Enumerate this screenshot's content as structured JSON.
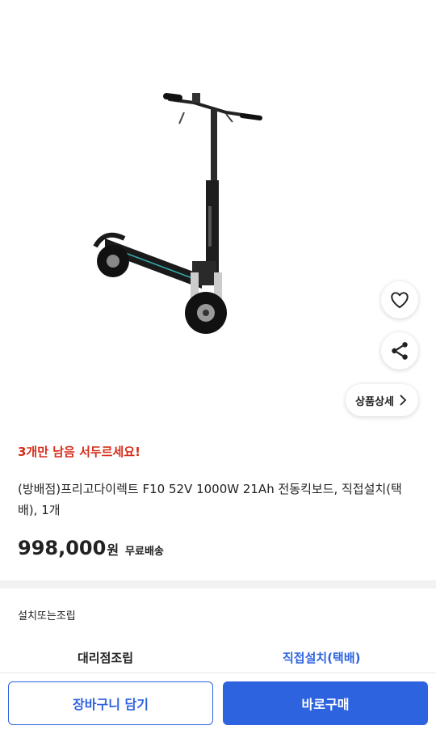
{
  "product": {
    "image_alt": "electric-scooter-image",
    "stock_notice": "3개만 남음 서두르세요!",
    "title": "(방배점)프리고다이렉트 F10 52V 1000W 21Ah 전동킥보드, 직접설치(택배), 1개",
    "price": "998,000",
    "currency": "원",
    "shipping": "무료배송"
  },
  "actions": {
    "wishlist_icon": "heart-icon",
    "share_icon": "share-icon",
    "detail_label": "상품상세"
  },
  "options": {
    "label": "설치또는조립",
    "choices": [
      "대리점조립",
      "직접설치(택배)"
    ],
    "selected": "직접설치(택배)"
  },
  "bottom_bar": {
    "cart_label": "장바구니 담기",
    "buy_label": "바로구매"
  },
  "colors": {
    "accent": "#2e63e0",
    "warning": "#d62d1a"
  }
}
